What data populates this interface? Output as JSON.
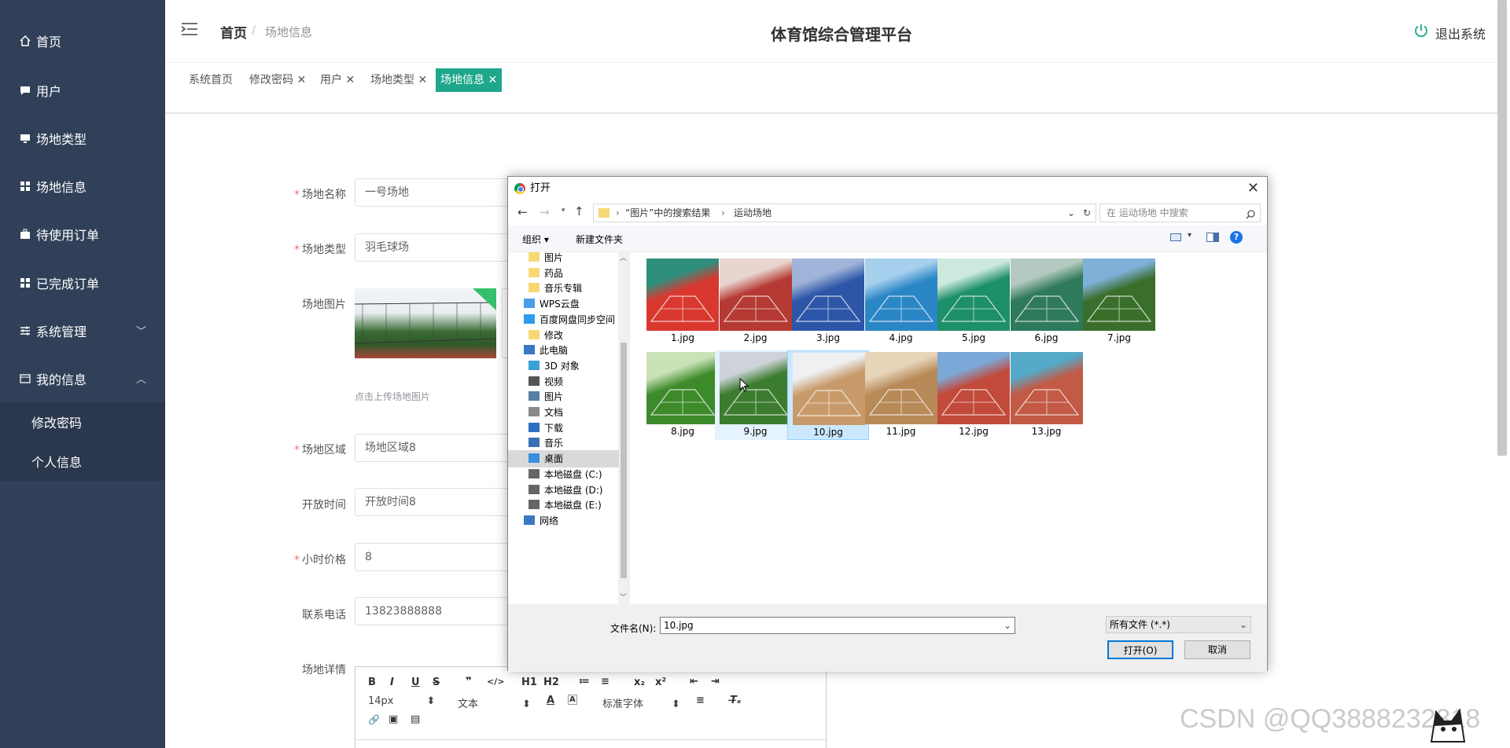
{
  "sidebar": {
    "items": [
      {
        "label": "首页",
        "icon": "home-icon"
      },
      {
        "label": "用户",
        "icon": "chat-icon"
      },
      {
        "label": "场地类型",
        "icon": "monitor-icon"
      },
      {
        "label": "场地信息",
        "icon": "grid-icon"
      },
      {
        "label": "待使用订单",
        "icon": "briefcase-icon"
      },
      {
        "label": "已完成订单",
        "icon": "grid-icon"
      },
      {
        "label": "系统管理",
        "icon": "sliders-icon"
      },
      {
        "label": "我的信息",
        "icon": "card-icon"
      }
    ],
    "submenu": [
      "修改密码",
      "个人信息"
    ]
  },
  "header": {
    "breadcrumb_home": "首页",
    "breadcrumb_sep": "/",
    "breadcrumb_current": "场地信息",
    "title": "体育馆综合管理平台",
    "logout": "退出系统"
  },
  "tabs": [
    {
      "label": "系统首页",
      "closable": false
    },
    {
      "label": "修改密码",
      "closable": true
    },
    {
      "label": "用户",
      "closable": true
    },
    {
      "label": "场地类型",
      "closable": true
    },
    {
      "label": "场地信息",
      "closable": true,
      "active": true
    }
  ],
  "form": {
    "name_label": "场地名称",
    "name_value": "一号场地",
    "type_label": "场地类型",
    "type_value": "羽毛球场",
    "image_label": "场地图片",
    "image_hint": "点击上传场地图片",
    "area_label": "场地区域",
    "area_value": "场地区域8",
    "open_label": "开放时间",
    "open_value": "开放时间8",
    "price_label": "小时价格",
    "price_value": "8",
    "phone_label": "联系电话",
    "phone_value": "13823888888",
    "detail_label": "场地详情"
  },
  "editor": {
    "row1": [
      "B",
      "I",
      "U",
      "S",
      "❞",
      "</>",
      "H1",
      "H2",
      "≔",
      "≡",
      "x₂",
      "x²",
      "⇤",
      "⇥"
    ],
    "font_size": "14px",
    "text_style": "文本",
    "font_family": "标准字体",
    "row3": [
      "🔗",
      "▣",
      "▤"
    ]
  },
  "dialog": {
    "title": "打开",
    "path_parts": [
      "“图片”中的搜索结果",
      "运动场地"
    ],
    "search_placeholder": "在 运动场地 中搜索",
    "organize": "组织 ▾",
    "new_folder": "新建文件夹",
    "tree": [
      {
        "label": "图片",
        "icon": "folder",
        "indent": 1
      },
      {
        "label": "药品",
        "icon": "folder",
        "indent": 1
      },
      {
        "label": "音乐专辑",
        "icon": "folder",
        "indent": 1
      },
      {
        "label": "WPS云盘",
        "icon": "cloud",
        "indent": 0
      },
      {
        "label": "百度网盘同步空间",
        "icon": "baidu",
        "indent": 0
      },
      {
        "label": "修改",
        "icon": "folder",
        "indent": 1
      },
      {
        "label": "此电脑",
        "icon": "pc",
        "indent": 0
      },
      {
        "label": "3D 对象",
        "icon": "cube",
        "indent": 1
      },
      {
        "label": "视频",
        "icon": "video",
        "indent": 1
      },
      {
        "label": "图片",
        "icon": "picture",
        "indent": 1
      },
      {
        "label": "文档",
        "icon": "doc",
        "indent": 1
      },
      {
        "label": "下载",
        "icon": "download",
        "indent": 1
      },
      {
        "label": "音乐",
        "icon": "music",
        "indent": 1
      },
      {
        "label": "桌面",
        "icon": "desktop",
        "indent": 1,
        "selected": true
      },
      {
        "label": "本地磁盘 (C:)",
        "icon": "drive",
        "indent": 1
      },
      {
        "label": "本地磁盘 (D:)",
        "icon": "drive",
        "indent": 1
      },
      {
        "label": "本地磁盘 (E:)",
        "icon": "drive",
        "indent": 1
      },
      {
        "label": "网络",
        "icon": "network",
        "indent": 0
      }
    ],
    "files": [
      {
        "name": "1.jpg",
        "bg": "#d9382f",
        "fg": "#2f8f7d"
      },
      {
        "name": "2.jpg",
        "bg": "#b53a33",
        "fg": "#e8d5d0"
      },
      {
        "name": "3.jpg",
        "bg": "#2e56a8",
        "fg": "#9fb4d8"
      },
      {
        "name": "4.jpg",
        "bg": "#2b86c6",
        "fg": "#a6d0ee"
      },
      {
        "name": "5.jpg",
        "bg": "#1d8f6a",
        "fg": "#cde9de"
      },
      {
        "name": "6.jpg",
        "bg": "#2f7a5b",
        "fg": "#b4c9bf"
      },
      {
        "name": "7.jpg",
        "bg": "#3a6f2b",
        "fg": "#7fb0d8"
      },
      {
        "name": "8.jpg",
        "bg": "#3d8a2a",
        "fg": "#c9e2b8"
      },
      {
        "name": "9.jpg",
        "bg": "#3c7c2f",
        "fg": "#cdd3d8",
        "hover": true
      },
      {
        "name": "10.jpg",
        "bg": "#c89a6a",
        "fg": "#eef0f2",
        "selected": true
      },
      {
        "name": "11.jpg",
        "bg": "#b78a58",
        "fg": "#e6d5b8"
      },
      {
        "name": "12.jpg",
        "bg": "#c24a3a",
        "fg": "#7ca8d8"
      },
      {
        "name": "13.jpg",
        "bg": "#c25a45",
        "fg": "#55a9c9"
      }
    ],
    "filename_label": "文件名(N):",
    "filename_value": "10.jpg",
    "filetype": "所有文件 (*.*)",
    "open_button": "打开(O)",
    "cancel_button": "取消"
  },
  "watermark": "CSDN @QQ3888232318",
  "colors": {
    "sidebar": "#314058",
    "accent": "#1ea78b",
    "required": "#f56c6c"
  }
}
